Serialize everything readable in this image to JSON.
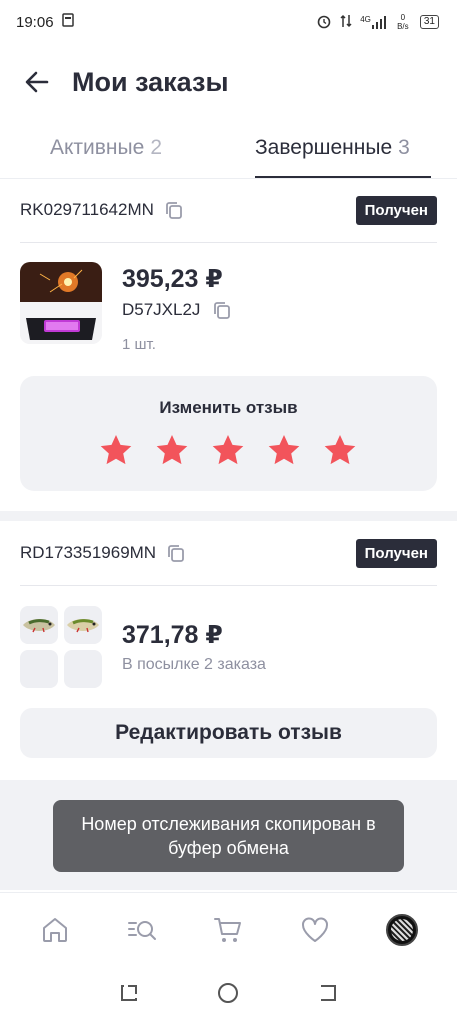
{
  "status_bar": {
    "time": "19:06",
    "net_speed": "0 B/s",
    "net_type": "4G",
    "battery": "31"
  },
  "header": {
    "title": "Мои заказы"
  },
  "tabs": [
    {
      "label": "Активные",
      "count": "2"
    },
    {
      "label": "Завершенные",
      "count": "3"
    }
  ],
  "orders": [
    {
      "tracking": "RK029711642MN",
      "status": "Получен",
      "price": "395,23 ₽",
      "sku": "D57JXL2J",
      "qty": "1 шт.",
      "review_title": "Изменить отзыв",
      "rating": 5
    },
    {
      "tracking": "RD173351969MN",
      "status": "Получен",
      "price": "371,78 ₽",
      "pack_note": "В посылке 2 заказа",
      "edit_label": "Редактировать отзыв"
    }
  ],
  "toast": {
    "text": "Номер отслеживания скопирован в буфер обмена"
  },
  "bottom_nav": [
    "home-icon",
    "catalog-search-icon",
    "cart-icon",
    "heart-icon",
    "profile-avatar"
  ],
  "colors": {
    "primary_text": "#2b2d3a",
    "muted_text": "#8e90a0",
    "star": "#f2545b",
    "badge_bg": "#2b2d3a",
    "card_bg": "#f1f2f5",
    "toast_bg": "#5f6064"
  }
}
